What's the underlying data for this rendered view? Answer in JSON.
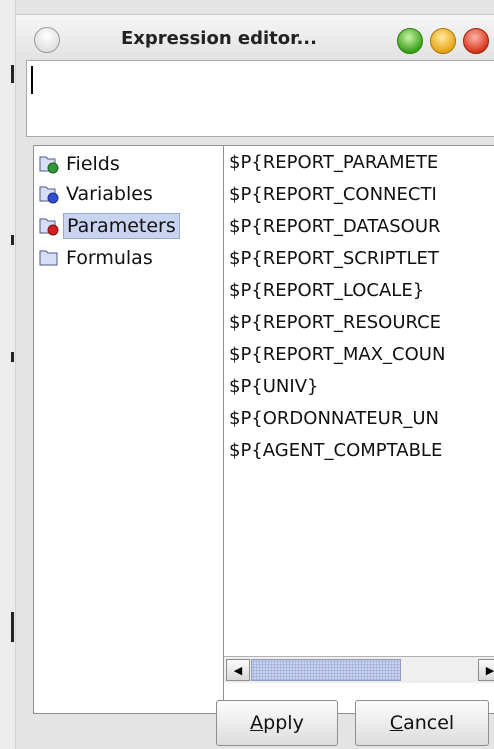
{
  "window": {
    "title": "Expression editor..."
  },
  "expression": {
    "value": ""
  },
  "tree": {
    "items": [
      {
        "label": "Fields",
        "icon": "fields-icon",
        "icon_color": "#2f9a3a",
        "selected": false
      },
      {
        "label": "Variables",
        "icon": "variables-icon",
        "icon_color": "#2f4fd0",
        "selected": false
      },
      {
        "label": "Parameters",
        "icon": "parameters-icon",
        "icon_color": "#d02020",
        "selected": true
      },
      {
        "label": "Formulas",
        "icon": "formulas-icon",
        "selected": false
      }
    ]
  },
  "parameters": {
    "items": [
      "$P{REPORT_PARAMETE",
      "$P{REPORT_CONNECTI",
      "$P{REPORT_DATASOUR",
      "$P{REPORT_SCRIPTLET",
      "$P{REPORT_LOCALE}",
      "$P{REPORT_RESOURCE",
      "$P{REPORT_MAX_COUN",
      "$P{UNIV}",
      "$P{ORDONNATEUR_UN",
      "$P{AGENT_COMPTABLE"
    ]
  },
  "buttons": {
    "apply": {
      "mnemonic": "A",
      "rest": "pply"
    },
    "cancel": {
      "mnemonic": "C",
      "rest": "ancel"
    }
  },
  "colors": {
    "selection": "#c8d4f0",
    "close": "#d8361d",
    "minimize": "#e7a414",
    "zoom": "#3aa018"
  }
}
